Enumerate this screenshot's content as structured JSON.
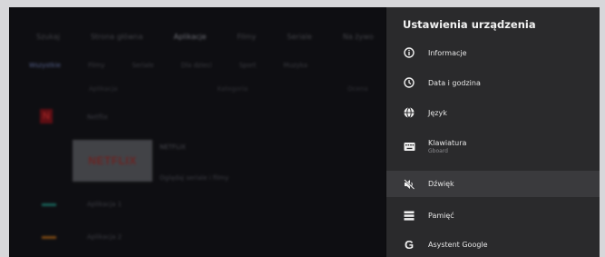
{
  "background_app": {
    "top_nav": [
      "Szukaj",
      "Strona główna",
      "Aplikacje",
      "Filmy",
      "Seriale",
      "Na żywo"
    ],
    "sub_tabs": [
      "Wszystkie",
      "Filmy",
      "Seriale",
      "Dla dzieci",
      "Sport",
      "Muzyka"
    ],
    "column_headers": [
      "Aplikacja",
      "Kategoria",
      "Ocena"
    ],
    "rows": [
      "Netflix",
      "NETFLIX",
      "Oglądaj seriale i filmy",
      "Aplikacja 1",
      "Aplikacja 2"
    ],
    "netflix_tile_text": "NETFLIX"
  },
  "panel": {
    "title": "Ustawienia urządzenia",
    "items": [
      {
        "label": "Informacje",
        "icon": "info-icon"
      },
      {
        "label": "Data i godzina",
        "icon": "clock-icon"
      },
      {
        "label": "Język",
        "icon": "globe-icon"
      },
      {
        "label": "Klawiatura",
        "sublabel": "Gboard",
        "icon": "keyboard-icon"
      },
      {
        "label": "Dźwięk",
        "icon": "sound-off-icon",
        "selected": true
      },
      {
        "label": "Pamięć",
        "icon": "storage-icon"
      },
      {
        "label": "Asystent Google",
        "icon": "google-icon"
      }
    ]
  },
  "colors": {
    "panel_bg": "#2a2a2c",
    "selected_row": "#3a3a3d",
    "text": "#e6e6e6"
  }
}
